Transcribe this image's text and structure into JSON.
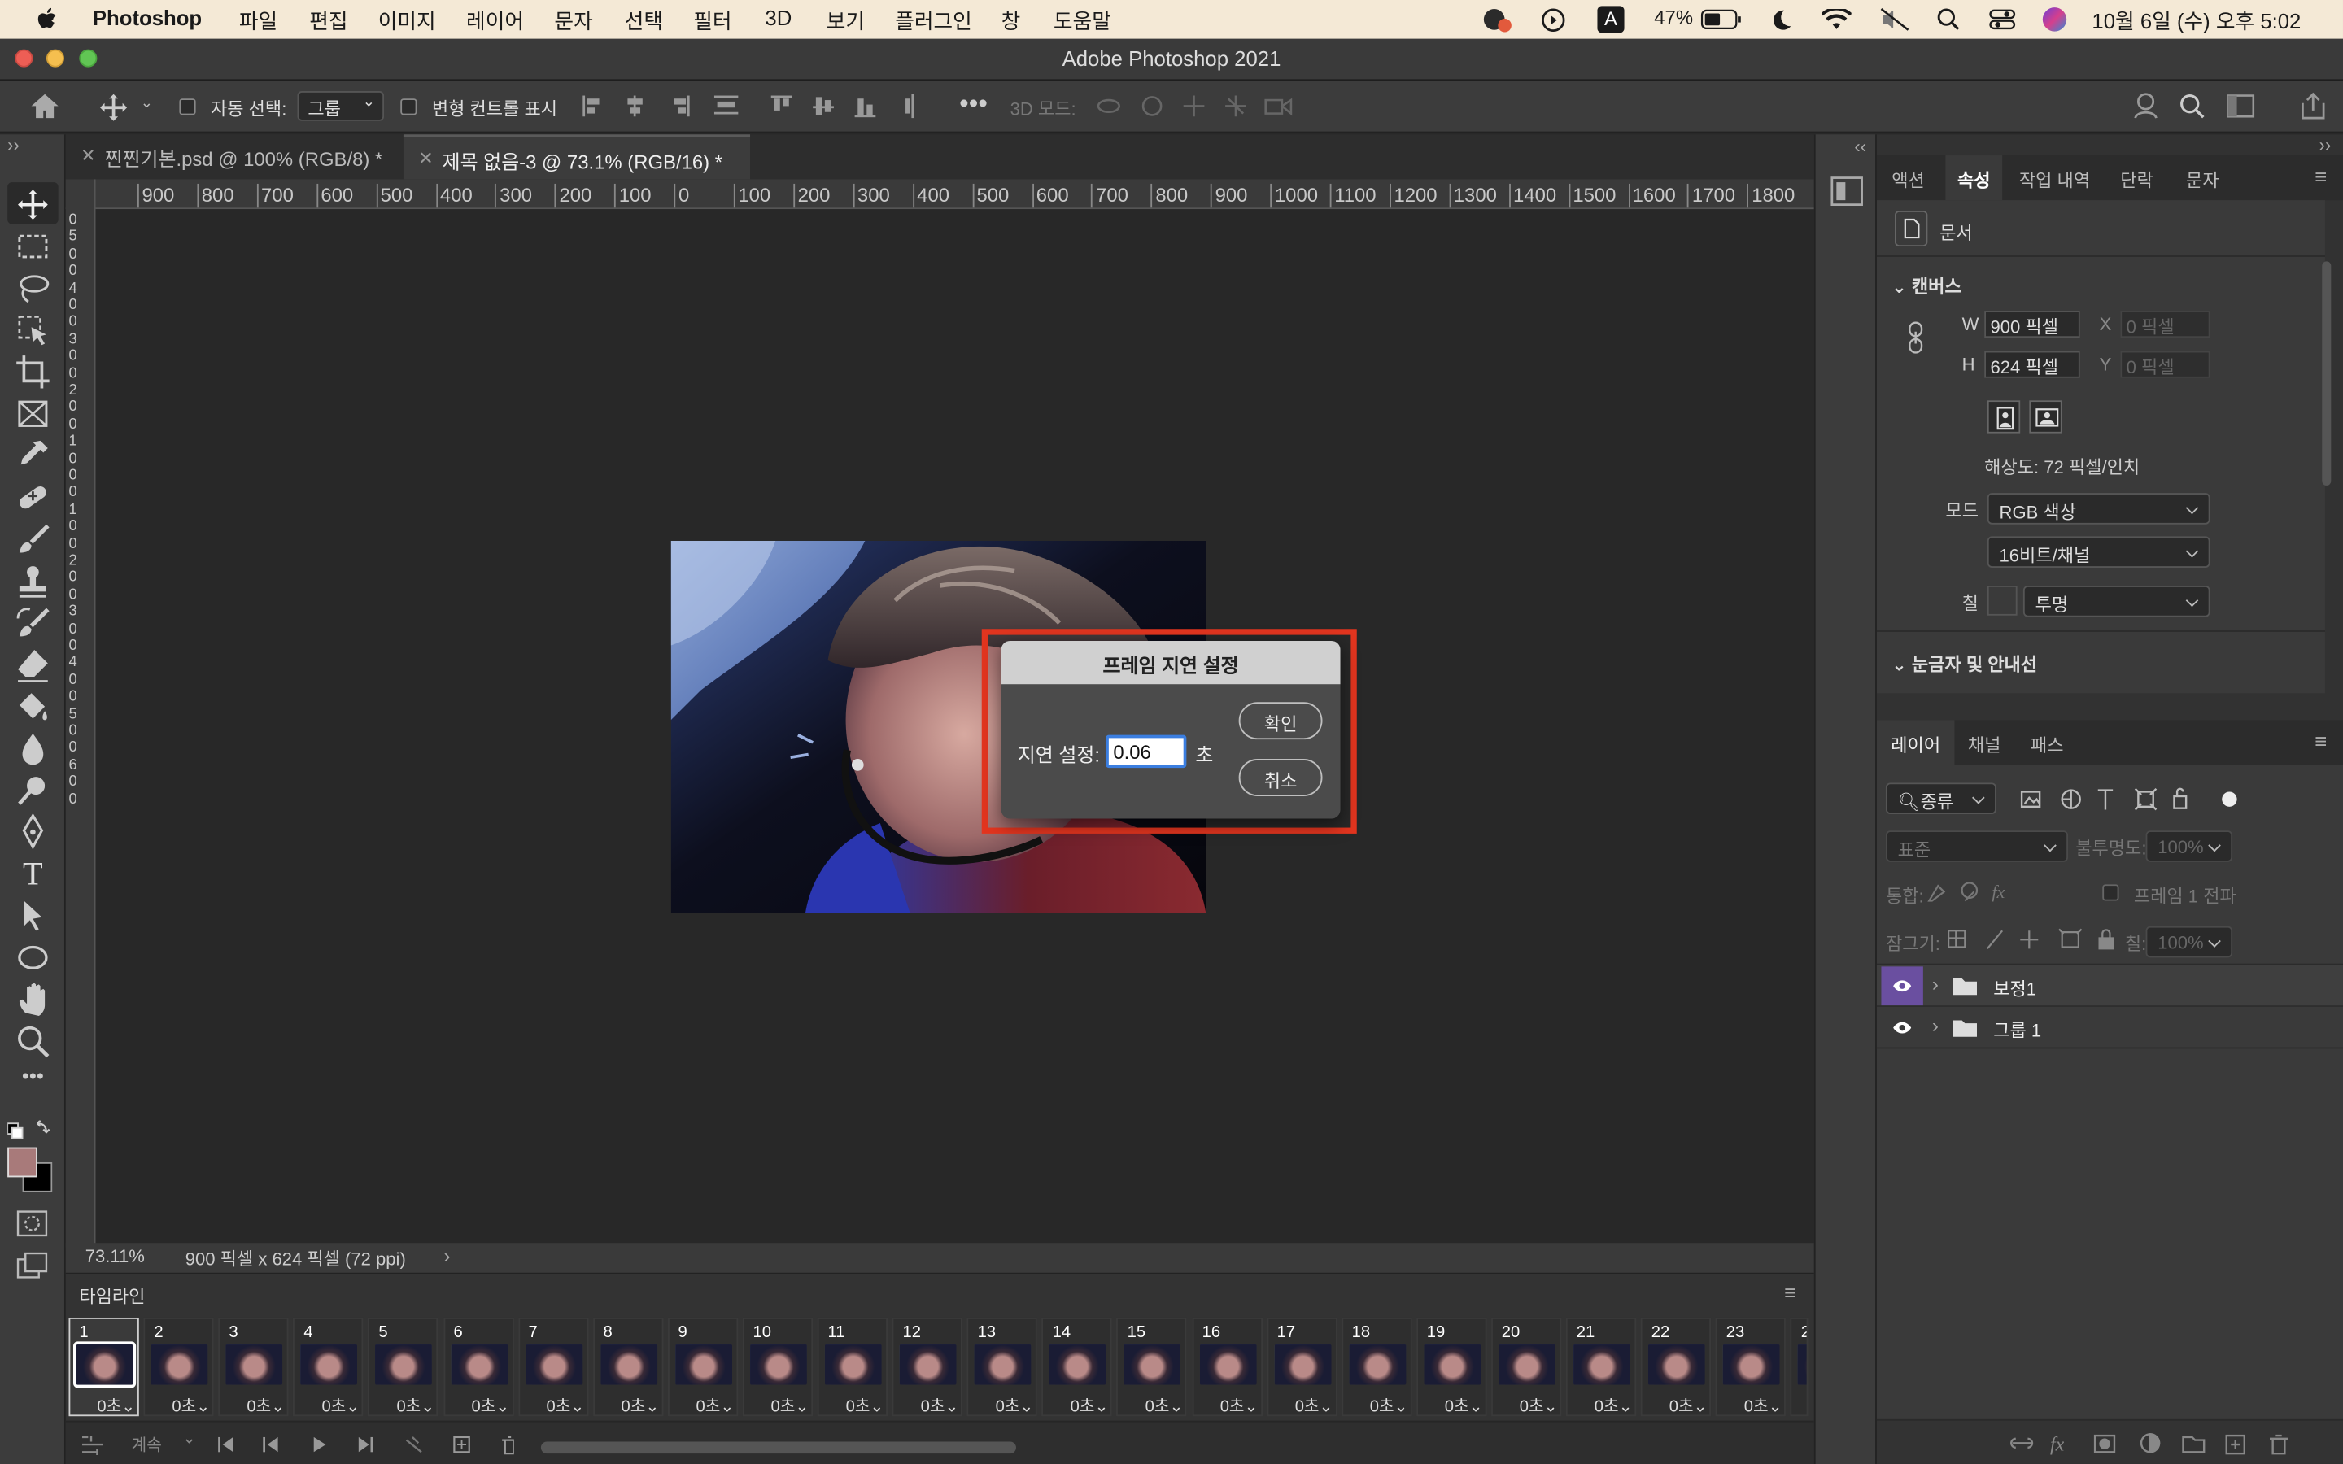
{
  "menubar": {
    "app": "Photoshop",
    "items": [
      "파일",
      "편집",
      "이미지",
      "레이어",
      "문자",
      "선택",
      "필터",
      "3D",
      "보기",
      "플러그인",
      "창",
      "도움말"
    ],
    "battery": "47%",
    "clock": "10월 6일 (수) 오후 5:02"
  },
  "window": {
    "title": "Adobe Photoshop 2021"
  },
  "options": {
    "auto_select_label": "자동 선택:",
    "auto_select_value": "그룹",
    "transform_label": "변형 컨트롤 표시",
    "mode3d_label": "3D 모드:"
  },
  "tabs": [
    {
      "label": "찐찐기본.psd @ 100% (RGB/8) *"
    },
    {
      "label": "제목 없음-3 @ 73.1% (RGB/16) *"
    }
  ],
  "ruler": {
    "h_ticks": [
      "900",
      "800",
      "700",
      "600",
      "500",
      "400",
      "300",
      "200",
      "100",
      "0",
      "100",
      "200",
      "300",
      "400",
      "500",
      "600",
      "700",
      "800",
      "900",
      "1000",
      "1100",
      "1200",
      "1300",
      "1400",
      "1500",
      "1600",
      "1700",
      "1800"
    ],
    "v_ticks": [
      "0",
      "5",
      "0",
      "0",
      "4",
      "0",
      "0",
      "3",
      "0",
      "0",
      "2",
      "0",
      "0",
      "1",
      "0",
      "0",
      "0",
      "1",
      "0",
      "0",
      "2",
      "0",
      "0",
      "3",
      "0",
      "0",
      "4",
      "0",
      "0",
      "5",
      "0",
      "0",
      "6",
      "0",
      "0"
    ]
  },
  "status": {
    "zoom": "73.11%",
    "doc_info": "900 픽셀 x 624 픽셀 (72 ppi)"
  },
  "timeline": {
    "title": "타임라인",
    "loop": "계속",
    "frames": [
      {
        "num": "1",
        "delay": "0초"
      },
      {
        "num": "2",
        "delay": "0초"
      },
      {
        "num": "3",
        "delay": "0초"
      },
      {
        "num": "4",
        "delay": "0초"
      },
      {
        "num": "5",
        "delay": "0초"
      },
      {
        "num": "6",
        "delay": "0초"
      },
      {
        "num": "7",
        "delay": "0초"
      },
      {
        "num": "8",
        "delay": "0초"
      },
      {
        "num": "9",
        "delay": "0초"
      },
      {
        "num": "10",
        "delay": "0초"
      },
      {
        "num": "11",
        "delay": "0초"
      },
      {
        "num": "12",
        "delay": "0초"
      },
      {
        "num": "13",
        "delay": "0초"
      },
      {
        "num": "14",
        "delay": "0초"
      },
      {
        "num": "15",
        "delay": "0초"
      },
      {
        "num": "16",
        "delay": "0초"
      },
      {
        "num": "17",
        "delay": "0초"
      },
      {
        "num": "18",
        "delay": "0초"
      },
      {
        "num": "19",
        "delay": "0초"
      },
      {
        "num": "20",
        "delay": "0초"
      },
      {
        "num": "21",
        "delay": "0초"
      },
      {
        "num": "22",
        "delay": "0초"
      },
      {
        "num": "23",
        "delay": "0초"
      },
      {
        "num": "2",
        "delay": ""
      }
    ]
  },
  "dialog": {
    "title": "프레임 지연 설정",
    "field_label": "지연 설정:",
    "value": "0.06",
    "unit": "초",
    "ok": "확인",
    "cancel": "취소"
  },
  "properties": {
    "tabs": [
      "액션",
      "속성",
      "작업 내역",
      "단락",
      "문자"
    ],
    "doc_label": "문서",
    "canvas_section": "캔버스",
    "w_label": "W",
    "w_value": "900 픽셀",
    "h_label": "H",
    "h_value": "624 픽셀",
    "x_label": "X",
    "x_placeholder": "0 픽셀",
    "y_label": "Y",
    "y_placeholder": "0 픽셀",
    "resolution": "해상도: 72 픽셀/인치",
    "mode_label": "모드",
    "mode_value": "RGB 색상",
    "depth_value": "16비트/채널",
    "fill_label": "칠",
    "fill_value": "투명",
    "rulers_section": "눈금자 및 안내선"
  },
  "layers": {
    "tabs": [
      "레이어",
      "채널",
      "패스"
    ],
    "filter_kind": "종류",
    "blend": "표준",
    "opacity_label": "불투명도:",
    "opacity": "100%",
    "unify_label": "통합:",
    "propagate_label": "프레임 1 전파",
    "lock_label": "잠그기:",
    "fill_label": "칠:",
    "fill": "100%",
    "items": [
      {
        "name": "보정1"
      },
      {
        "name": "그룹 1"
      }
    ]
  },
  "colors": {
    "accent": "#e2351f",
    "foreground": "#a87a7a",
    "layer_eye_selected": "#6a4fa0"
  }
}
